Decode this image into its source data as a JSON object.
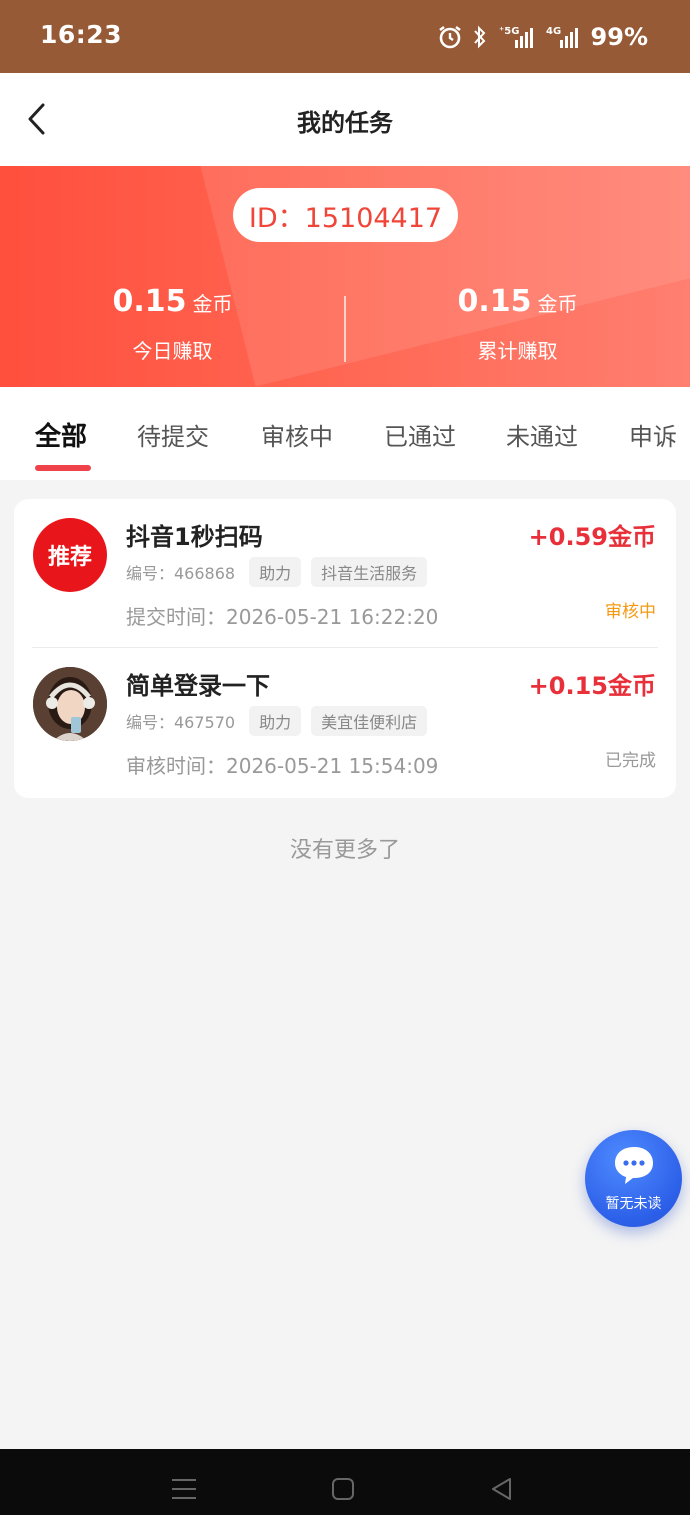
{
  "status_bar": {
    "time": "16:23",
    "battery": "99%",
    "icons": [
      "alarm-icon",
      "bluetooth-icon",
      "5g-signal-icon",
      "4g-signal-icon"
    ]
  },
  "header": {
    "title": "我的任务"
  },
  "banner": {
    "id_text": "ID：15104417",
    "today": {
      "value": "0.15",
      "unit": "金币",
      "label": "今日赚取"
    },
    "total": {
      "value": "0.15",
      "unit": "金币",
      "label": "累计赚取"
    }
  },
  "tabs": [
    {
      "label": "全部",
      "active": true
    },
    {
      "label": "待提交"
    },
    {
      "label": "审核中"
    },
    {
      "label": "已通过"
    },
    {
      "label": "未通过"
    },
    {
      "label": "申诉"
    }
  ],
  "tasks": [
    {
      "avatar_text": "推荐",
      "title": "抖音1秒扫码",
      "reward": "+0.59金币",
      "number": "编号：466868",
      "tags": [
        "助力",
        "抖音生活服务"
      ],
      "time": "提交时间：2026-05-21 16:22:20",
      "status": "审核中"
    },
    {
      "avatar_text": "",
      "title": "简单登录一下",
      "reward": "+0.15金币",
      "number": "编号：467570",
      "tags": [
        "助力",
        "美宜佳便利店"
      ],
      "time": "审核时间：2026-05-21 15:54:09",
      "status": "已完成"
    }
  ],
  "no_more_text": "没有更多了",
  "chat_fab": {
    "label": "暂无未读"
  },
  "colors": {
    "status_bar": "#965a36",
    "banner": "#ff5a48",
    "accent_red": "#e8303a",
    "status_reviewing": "#f39a12",
    "fab": "#2c5fe8"
  }
}
